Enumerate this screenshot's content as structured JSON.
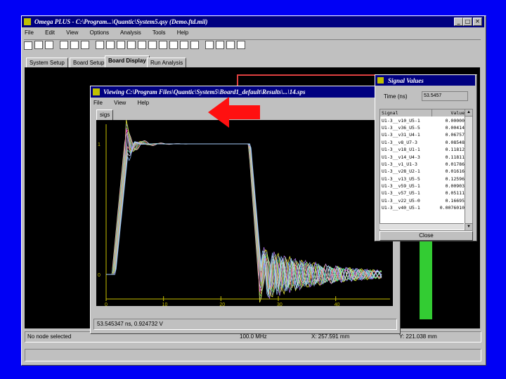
{
  "colors": {
    "slide_bg": "#0000f5",
    "titlebar": "#000080",
    "window": "#c0c0c0",
    "plot_bg": "#000000",
    "arrow": "#ff1010",
    "connector": "#e04040",
    "trace_green": "#33cc33"
  },
  "main_window": {
    "title": "Omega PLUS - C:\\Program...\\Quantic\\System5.qsy (Demo.ftd.mil)",
    "menu": [
      "File",
      "Edit",
      "View",
      "Options",
      "Analysis",
      "Tools",
      "Help"
    ],
    "tabs": [
      "System Setup",
      "Board Setup",
      "Board Display",
      "Run Analysis"
    ],
    "active_tab": "Board Display",
    "status": {
      "left": "No node selected",
      "freq": "100.0 MHz",
      "x": "X: 257.591 mm",
      "y": "Y: 221.038 mm"
    }
  },
  "viewing_window": {
    "title": "Viewing C:\\Program Files\\Quantic\\System5\\Board1_default\\Results\\...\\14.sps",
    "menu": [
      "File",
      "View",
      "Help"
    ],
    "tab": "sigs",
    "readout": "53.545347 ns, 0.924732 V"
  },
  "plot": {
    "x_ticks": [
      "0",
      "10",
      "20",
      "30",
      "40"
    ],
    "y_ticks": [
      "1",
      "0"
    ]
  },
  "signal_values": {
    "title": "Signal Values",
    "time_label": "Time (ns)",
    "time_value": "53.5457",
    "col_signal": "Signal",
    "col_value": "Value",
    "rows": [
      {
        "s": "U1-3__v10_U5-1",
        "v": "0.00000"
      },
      {
        "s": "U1-3__v36_U5-5",
        "v": "0.00414"
      },
      {
        "s": "U1-3__v31_U4-1",
        "v": "0.06757"
      },
      {
        "s": "U1-3__v8_U7-3",
        "v": "0.08548"
      },
      {
        "s": "U1-3__v18_U1-1",
        "v": "0.11812"
      },
      {
        "s": "U1-3__v14_U4-3",
        "v": "0.11811"
      },
      {
        "s": "U1-3__v1_U1-3",
        "v": "0.01786"
      },
      {
        "s": "U1-3__v28_U2-1",
        "v": "0.01616"
      },
      {
        "s": "U1-3__v13_U5-5",
        "v": "0.12596"
      },
      {
        "s": "U1-3__v59_U5-1",
        "v": "0.00903"
      },
      {
        "s": "U1-3__v57_U5-1",
        "v": "0.05111"
      },
      {
        "s": "U1-3__v22_U5-0",
        "v": "0.16695"
      },
      {
        "s": "U1-3__v40_U5-1",
        "v": "0.0076010"
      }
    ],
    "close_label": "Close"
  }
}
